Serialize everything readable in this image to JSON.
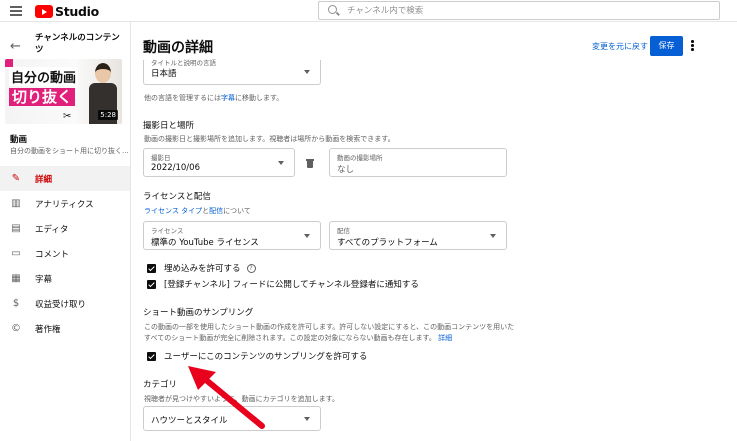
{
  "app": {
    "name": "Studio"
  },
  "search": {
    "placeholder": "チャンネル内で検索"
  },
  "sidebar": {
    "title": "チャンネルのコンテンツ",
    "thumbnail": {
      "line1": "自分の動画",
      "line2": "切り抜く",
      "duration": "5:28"
    },
    "video_title": "動画",
    "video_subtitle": "自分の動画をショート用に切り抜く...",
    "items": [
      {
        "label": "詳細",
        "icon": "pencil-icon",
        "active": true
      },
      {
        "label": "アナリティクス",
        "icon": "analytics-icon",
        "active": false
      },
      {
        "label": "エディタ",
        "icon": "editor-icon",
        "active": false
      },
      {
        "label": "コメント",
        "icon": "comment-icon",
        "active": false
      },
      {
        "label": "字幕",
        "icon": "subtitles-icon",
        "active": false
      },
      {
        "label": "収益受け取り",
        "icon": "dollar-icon",
        "active": false
      },
      {
        "label": "著作権",
        "icon": "copyright-icon",
        "active": false
      }
    ]
  },
  "main": {
    "title": "動画の詳細",
    "undo_label": "変更を元に戻す",
    "save_label": "保存",
    "language": {
      "field_label": "タイトルと説明の言語",
      "value": "日本語",
      "note_prefix": "他の言語を管理するには",
      "note_link": "字幕",
      "note_suffix": "に移動します。"
    },
    "recording": {
      "heading": "撮影日と場所",
      "description": "動画の撮影日と撮影場所を追加します。視聴者は場所から動画を検索できます。",
      "date_label": "撮影日",
      "date_value": "2022/10/06",
      "location_label": "動画の撮影場所",
      "location_value": "なし"
    },
    "license": {
      "heading": "ライセンスと配信",
      "link1": "ライセンス タイプ",
      "link_sep": "と",
      "link2": "配信",
      "link_suffix": "について",
      "license_label": "ライセンス",
      "license_value": "標準の YouTube ライセンス",
      "distribution_label": "配信",
      "distribution_value": "すべてのプラットフォーム",
      "allow_embed": "埋め込みを許可する",
      "notify_subscribers": "[登録チャンネル] フィードに公開してチャンネル登録者に通知する"
    },
    "shorts_sampling": {
      "heading": "ショート動画のサンプリング",
      "description_line1": "この動画の一部を使用したショート動画の作成を許可します。許可しない設定にすると、この動画コンテンツを用いた",
      "description_line2": "すべてのショート動画が完全に削除されます。この設定の対象にならない動画も存在します。",
      "details_link": "詳細",
      "allow_label": "ユーザーにこのコンテンツのサンプリングを許可する"
    },
    "category": {
      "heading": "カテゴリ",
      "description": "視聴者が見つけやすいように、動画にカテゴリを追加します。",
      "value": "ハウツーとスタイル"
    }
  },
  "colors": {
    "accent": "#065fd4",
    "brand_red": "#ff0000",
    "active_red": "#cc0000",
    "arrow": "#e8001c"
  }
}
